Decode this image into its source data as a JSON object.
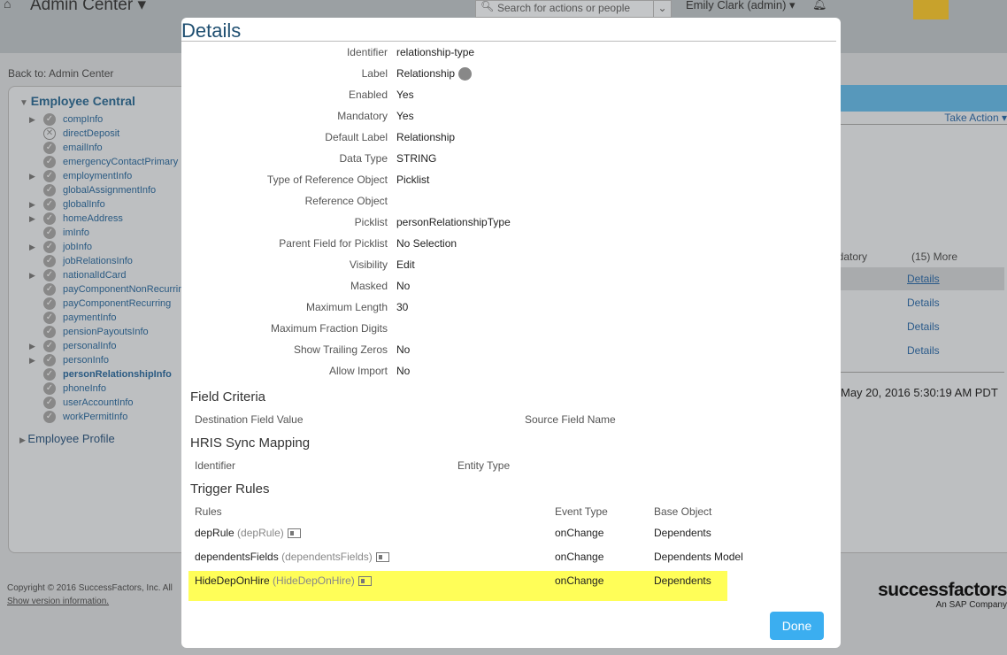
{
  "header": {
    "title": "Admin Center",
    "search_placeholder": "Search for actions or people",
    "user": "Emily Clark (admin)"
  },
  "back_link": "Back to: Admin Center",
  "sidebar": {
    "section": "Employee Central",
    "section2": "Employee Profile",
    "items": [
      {
        "label": "compInfo",
        "expandable": true,
        "status": "check"
      },
      {
        "label": "directDeposit",
        "expandable": false,
        "status": "x"
      },
      {
        "label": "emailInfo",
        "expandable": false,
        "status": "check"
      },
      {
        "label": "emergencyContactPrimary",
        "expandable": false,
        "status": "check"
      },
      {
        "label": "employmentInfo",
        "expandable": true,
        "status": "check"
      },
      {
        "label": "globalAssignmentInfo",
        "expandable": false,
        "status": "check"
      },
      {
        "label": "globalInfo",
        "expandable": true,
        "status": "check"
      },
      {
        "label": "homeAddress",
        "expandable": true,
        "status": "check"
      },
      {
        "label": "imInfo",
        "expandable": false,
        "status": "check"
      },
      {
        "label": "jobInfo",
        "expandable": true,
        "status": "check"
      },
      {
        "label": "jobRelationsInfo",
        "expandable": false,
        "status": "check"
      },
      {
        "label": "nationalIdCard",
        "expandable": true,
        "status": "check"
      },
      {
        "label": "payComponentNonRecurring",
        "expandable": false,
        "status": "check"
      },
      {
        "label": "payComponentRecurring",
        "expandable": false,
        "status": "check"
      },
      {
        "label": "paymentInfo",
        "expandable": false,
        "status": "check"
      },
      {
        "label": "pensionPayoutsInfo",
        "expandable": false,
        "status": "check"
      },
      {
        "label": "personalInfo",
        "expandable": true,
        "status": "check"
      },
      {
        "label": "personInfo",
        "expandable": true,
        "status": "check"
      },
      {
        "label": "personRelationshipInfo",
        "expandable": false,
        "status": "check",
        "bold": true
      },
      {
        "label": "phoneInfo",
        "expandable": false,
        "status": "check"
      },
      {
        "label": "userAccountInfo",
        "expandable": false,
        "status": "check"
      },
      {
        "label": "workPermitInfo",
        "expandable": false,
        "status": "check"
      }
    ]
  },
  "background": {
    "take_action": "Take Action",
    "col_mandatory": "ndatory",
    "col_more": "(15) More",
    "details": [
      "Details",
      "Details",
      "Details",
      "Details"
    ],
    "date": "May 20, 2016 5:30:19 AM PDT"
  },
  "footer": {
    "copyright": "Copyright © 2016 SuccessFactors, Inc. All",
    "version": "Show version information.",
    "brand": "successfactors",
    "brand_sub": "An SAP Company"
  },
  "modal": {
    "title": "Details",
    "fields": [
      {
        "label": "Identifier",
        "value": "relationship-type"
      },
      {
        "label": "Label",
        "value": "Relationship"
      },
      {
        "label": "Enabled",
        "value": "Yes"
      },
      {
        "label": "Mandatory",
        "value": "Yes"
      },
      {
        "label": "Default Label",
        "value": "Relationship"
      },
      {
        "label": "Data Type",
        "value": "STRING"
      },
      {
        "label": "Type of Reference Object",
        "value": "Picklist"
      },
      {
        "label": "Reference Object",
        "value": ""
      },
      {
        "label": "Picklist",
        "value": "personRelationshipType"
      },
      {
        "label": "Parent Field for Picklist",
        "value": "No Selection"
      },
      {
        "label": "Visibility",
        "value": "Edit"
      },
      {
        "label": "Masked",
        "value": "No"
      },
      {
        "label": "Maximum Length",
        "value": "30"
      },
      {
        "label": "Maximum Fraction Digits",
        "value": ""
      },
      {
        "label": "Show Trailing Zeros",
        "value": "No"
      },
      {
        "label": "Allow Import",
        "value": "No"
      }
    ],
    "field_criteria": {
      "title": "Field Criteria",
      "col1": "Destination Field Value",
      "col2": "Source Field Name"
    },
    "hris": {
      "title": "HRIS Sync Mapping",
      "col1": "Identifier",
      "col2": "Entity Type"
    },
    "trigger": {
      "title": "Trigger Rules",
      "col1": "Rules",
      "col2": "Event Type",
      "col3": "Base Object",
      "rows": [
        {
          "name": "depRule",
          "code": "(depRule)",
          "event": "onChange",
          "base": "Dependents"
        },
        {
          "name": "dependentsFields",
          "code": "(dependentsFields)",
          "event": "onChange",
          "base": "Dependents Model"
        },
        {
          "name": "HideDepOnHire",
          "code": "(HideDepOnHire)",
          "event": "onChange",
          "base": "Dependents",
          "highlighted": true
        }
      ]
    },
    "done": "Done"
  },
  "colors": {
    "accent": "#3baef0",
    "highlight": "#fffe58",
    "title": "#1e4e70"
  }
}
